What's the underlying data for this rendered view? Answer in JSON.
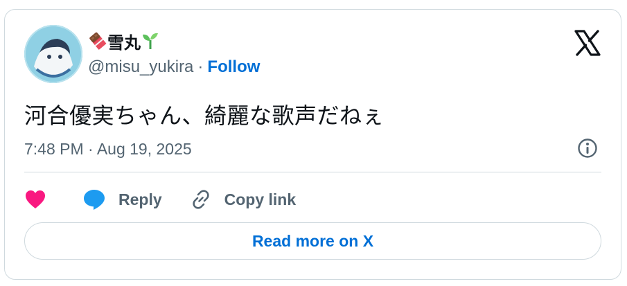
{
  "author": {
    "display_name": "雪丸",
    "handle": "@misu_yukira",
    "separator": "·",
    "follow_label": "Follow",
    "name_prefix_icon": "chocolate-bar-icon",
    "name_suffix_icon": "seedling-icon"
  },
  "tweet": {
    "text": "河合優実ちゃん、綺麗な歌声だねぇ",
    "timestamp": "7:48 PM · Aug 19, 2025"
  },
  "actions": {
    "like_icon": "heart-icon",
    "reply_label": "Reply",
    "copy_label": "Copy link"
  },
  "read_more_label": "Read more on X",
  "colors": {
    "accent": "#006fd6",
    "like": "#f91880",
    "reply": "#1d9bf0",
    "text": "#0f1419",
    "muted": "#536471",
    "border": "#cfd9de"
  }
}
